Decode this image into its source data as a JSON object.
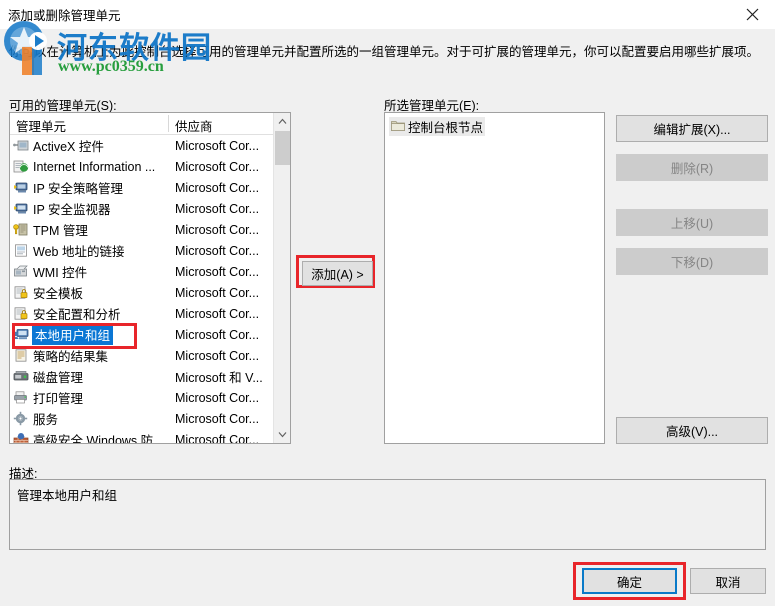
{
  "window": {
    "title": "添加或删除管理单元",
    "close_icon": "close-icon"
  },
  "instruction": "你可以在计算机上为此控制台选择可用的管理单元并配置所选的一组管理单元。对于可扩展的管理单元，你可以配置要启用哪些扩展项。",
  "watermark": {
    "text": "河东软件园",
    "url": "www.pc0359.cn",
    "text_color": "#1478c8",
    "url_color": "#1f9b37"
  },
  "labels": {
    "available": "可用的管理单元(S):",
    "selected": "所选管理单元(E):",
    "description": "描述:"
  },
  "available_list": {
    "columns": [
      "管理单元",
      "供应商"
    ],
    "rows": [
      {
        "name": "ActiveX 控件",
        "vendor": "Microsoft Cor...",
        "icon": "activex-control-icon",
        "selected": false
      },
      {
        "name": "Internet Information ...",
        "vendor": "Microsoft Cor...",
        "icon": "iis-icon",
        "selected": false
      },
      {
        "name": "IP 安全策略管理",
        "vendor": "Microsoft Cor...",
        "icon": "ipsec-policy-icon",
        "selected": false
      },
      {
        "name": "IP 安全监视器",
        "vendor": "Microsoft Cor...",
        "icon": "ipsec-monitor-icon",
        "selected": false
      },
      {
        "name": "TPM 管理",
        "vendor": "Microsoft Cor...",
        "icon": "tpm-icon",
        "selected": false
      },
      {
        "name": "Web 地址的链接",
        "vendor": "Microsoft Cor...",
        "icon": "weblink-icon",
        "selected": false
      },
      {
        "name": "WMI 控件",
        "vendor": "Microsoft Cor...",
        "icon": "wmi-icon",
        "selected": false
      },
      {
        "name": "安全模板",
        "vendor": "Microsoft Cor...",
        "icon": "security-template-icon",
        "selected": false
      },
      {
        "name": "安全配置和分析",
        "vendor": "Microsoft Cor...",
        "icon": "security-config-icon",
        "selected": false
      },
      {
        "name": "本地用户和组",
        "vendor": "Microsoft Cor...",
        "icon": "local-users-groups-icon",
        "selected": true
      },
      {
        "name": "策略的结果集",
        "vendor": "Microsoft Cor...",
        "icon": "rsop-icon",
        "selected": false
      },
      {
        "name": "磁盘管理",
        "vendor": "Microsoft 和 V...",
        "icon": "disk-management-icon",
        "selected": false
      },
      {
        "name": "打印管理",
        "vendor": "Microsoft Cor...",
        "icon": "print-management-icon",
        "selected": false
      },
      {
        "name": "服务",
        "vendor": "Microsoft Cor...",
        "icon": "services-icon",
        "selected": false
      },
      {
        "name": "高级安全 Windows 防",
        "vendor": "Microsoft Cor...",
        "icon": "firewall-icon",
        "selected": false
      }
    ]
  },
  "selected_list": {
    "rows": [
      {
        "name": "控制台根节点",
        "icon": "folder-icon"
      }
    ]
  },
  "buttons": {
    "add": "添加(A)  >",
    "edit_extensions": "编辑扩展(X)...",
    "remove": "删除(R)",
    "move_up": "上移(U)",
    "move_down": "下移(D)",
    "advanced": "高级(V)...",
    "ok": "确定",
    "cancel": "取消"
  },
  "description": {
    "value": "管理本地用户和组"
  },
  "colors": {
    "highlight_red": "#e8252a",
    "selection_blue": "#0a76d4",
    "focus_blue": "#0a7ac8",
    "dialog_bg": "#f0f0f0"
  }
}
